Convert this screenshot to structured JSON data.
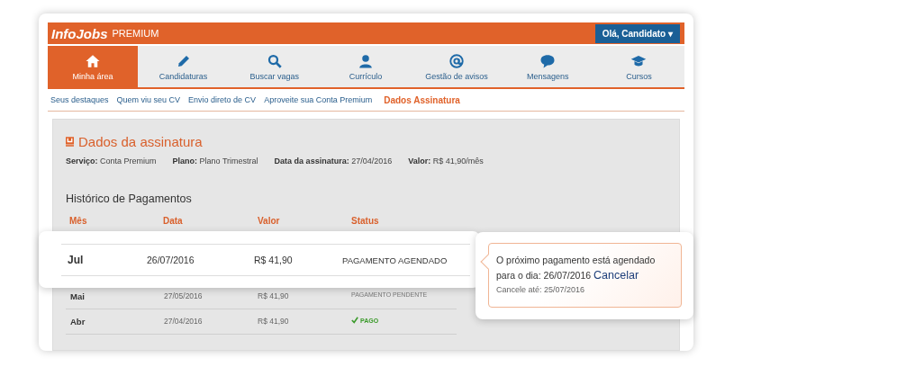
{
  "header": {
    "logo": "InfoJobs",
    "logo_suffix": "PREMIUM",
    "user_menu": "Olá, Candidato",
    "user_caret": "▾"
  },
  "nav": [
    {
      "label": "Minha área",
      "kind": "home",
      "selected": true
    },
    {
      "label": "Candidaturas",
      "kind": "pencil",
      "selected": false
    },
    {
      "label": "Buscar vagas",
      "kind": "search",
      "selected": false
    },
    {
      "label": "Currículo",
      "kind": "person",
      "selected": false
    },
    {
      "label": "Gestão de avisos",
      "kind": "at",
      "selected": false
    },
    {
      "label": "Mensagens",
      "kind": "chat",
      "selected": false
    },
    {
      "label": "Cursos",
      "kind": "cap",
      "selected": false
    }
  ],
  "subnav": [
    {
      "label": "Seus destaques",
      "selected": false
    },
    {
      "label": "Quem viu seu CV",
      "selected": false
    },
    {
      "label": "Envio direto de CV",
      "selected": false
    },
    {
      "label": "Aproveite sua Conta Premium",
      "selected": false
    },
    {
      "label": "Dados Assinatura",
      "selected": true
    }
  ],
  "subscription": {
    "title": "Dados da assinatura",
    "fields": [
      {
        "label": "Serviço:",
        "value": "Conta Premium"
      },
      {
        "label": "Plano:",
        "value": "Plano Trimestral"
      },
      {
        "label": "Data da assinatura:",
        "value": "27/04/2016"
      },
      {
        "label": "Valor:",
        "value": "R$ 41,90/mês"
      }
    ]
  },
  "history": {
    "title": "Histórico de Pagamentos",
    "columns": [
      "Mês",
      "Data",
      "Valor",
      "Status"
    ],
    "highlighted_row": {
      "month": "Jul",
      "date": "26/07/2016",
      "value": "R$ 41,90",
      "status": "PAGAMENTO AGENDADO"
    },
    "rows": [
      {
        "month": "Mai",
        "date": "27/05/2016",
        "value": "R$ 41,90",
        "status": "PAGAMENTO PENDENTE",
        "kind": "pending"
      },
      {
        "month": "Abr",
        "date": "27/04/2016",
        "value": "R$ 41,90",
        "status": "PAGO",
        "kind": "paid"
      }
    ]
  },
  "tooltip": {
    "text": "O próximo pagamento está agendado para o dia: 26/07/2016",
    "link": "Cancelar",
    "note": "Cancele até: 25/07/2016"
  }
}
